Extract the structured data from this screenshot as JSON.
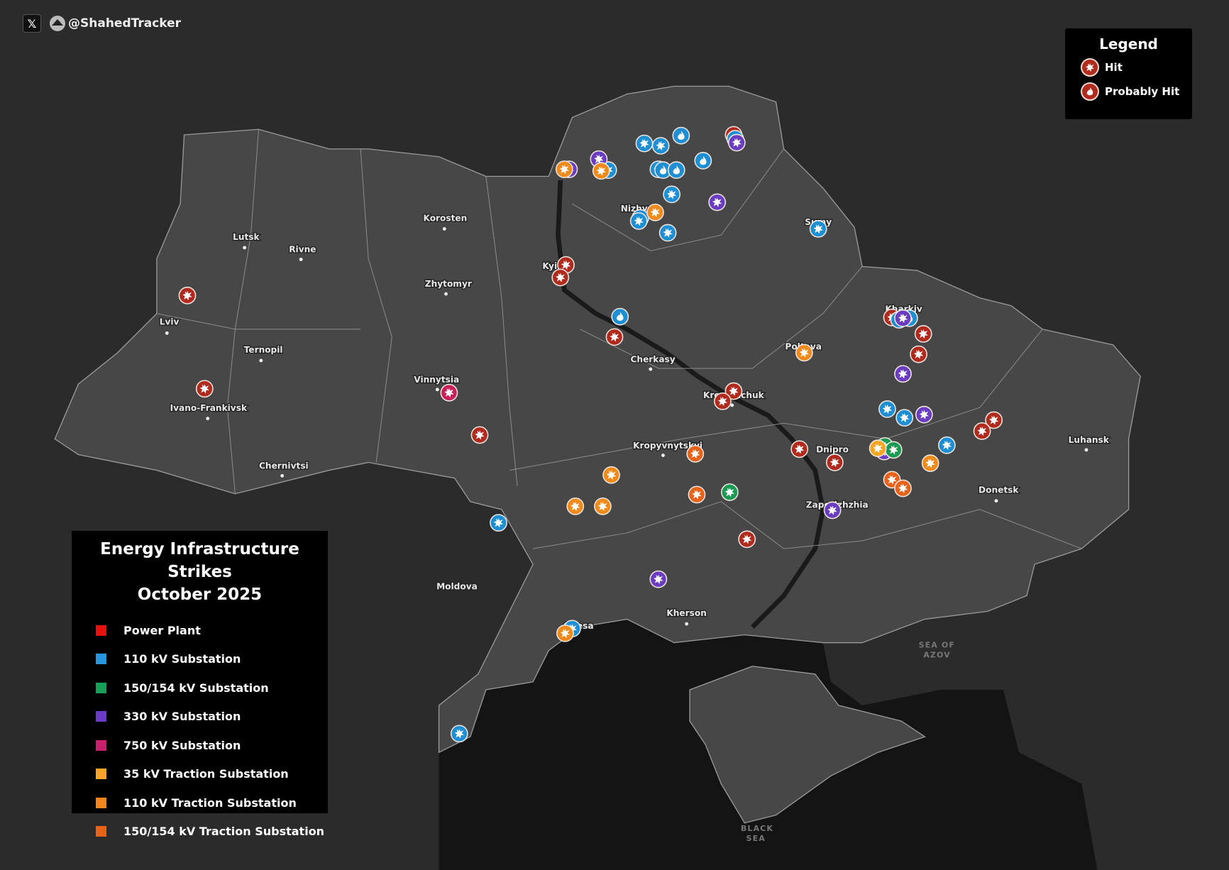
{
  "brand": {
    "x_icon": "x-logo-icon",
    "handle": "@ShahedTracker"
  },
  "status_legend": {
    "title": "Legend",
    "items": [
      {
        "label": "Hit",
        "icon": "explosion-icon"
      },
      {
        "label": "Probably Hit",
        "icon": "fire-icon"
      }
    ]
  },
  "key": {
    "title_line1": "Energy Infrastructure Strikes",
    "title_line2": "October 2025",
    "categories": [
      {
        "id": "power_plant",
        "label": "Power Plant",
        "color": "#e8100e"
      },
      {
        "id": "sub110",
        "label": "110 kV Substation",
        "color": "#2a96dc"
      },
      {
        "id": "sub150",
        "label": "150/154 kV Substation",
        "color": "#16a05a"
      },
      {
        "id": "sub330",
        "label": "330 kV Substation",
        "color": "#6a3cc4"
      },
      {
        "id": "sub750",
        "label": "750 kV Substation",
        "color": "#c8206a"
      },
      {
        "id": "tr35",
        "label": "35 kV Traction Substation",
        "color": "#f5a62a"
      },
      {
        "id": "tr110",
        "label": "110 kV Traction Substation",
        "color": "#f2861a"
      },
      {
        "id": "tr150",
        "label": "150/154 kV Traction Substation",
        "color": "#e8621a"
      }
    ]
  },
  "marker_colors": {
    "power_plant": "#b02a1e",
    "sub110": "#1e8fd2",
    "sub150": "#1a9a52",
    "sub330": "#6a3cc0",
    "sub750": "#c8205a",
    "tr35": "#f5a623",
    "tr110": "#f08a1a",
    "tr150": "#e8621a"
  },
  "map_colors": {
    "background": "#2b2b2b",
    "ukraine": "#474747",
    "sea": "#141414",
    "border": "#9a9a9a"
  },
  "cities": [
    "Korosten",
    "Lutsk",
    "Rivne",
    "Zhytomyr",
    "Lviv",
    "Ternopil",
    "Vinnytsia",
    "Ivano-Frankivsk",
    "Chernivtsi",
    "Cherkasy",
    "Kremenchuk",
    "Kropyvnytskyi",
    "Dnipro",
    "Zaporizhzhia",
    "Donetsk",
    "Luhansk",
    "Kharkiv",
    "Poltava",
    "Sumy",
    "Kyiv",
    "Nizhyn",
    "Odesa",
    "Kherson",
    "Moldova"
  ],
  "seas": {
    "azov_1": "SEA OF",
    "azov_2": "AZOV",
    "black_1": "BLACK",
    "black_2": "SEA"
  },
  "watermark": "@ShahedTracker",
  "markers": [
    {
      "category": "power_plant",
      "status": "hit"
    },
    {
      "category": "power_plant",
      "status": "hit"
    },
    {
      "category": "power_plant",
      "status": "hit"
    },
    {
      "category": "power_plant",
      "status": "hit"
    },
    {
      "category": "power_plant",
      "status": "hit"
    },
    {
      "category": "power_plant",
      "status": "hit"
    },
    {
      "category": "power_plant",
      "status": "hit"
    },
    {
      "category": "power_plant",
      "status": "hit"
    },
    {
      "category": "power_plant",
      "status": "hit"
    },
    {
      "category": "power_plant",
      "status": "hit"
    },
    {
      "category": "power_plant",
      "status": "hit"
    },
    {
      "category": "power_plant",
      "status": "hit"
    },
    {
      "category": "power_plant",
      "status": "hit"
    },
    {
      "category": "power_plant",
      "status": "hit"
    },
    {
      "category": "power_plant",
      "status": "hit"
    },
    {
      "category": "power_plant",
      "status": "hit"
    },
    {
      "category": "power_plant",
      "status": "hit"
    },
    {
      "category": "sub110",
      "status": "hit"
    },
    {
      "category": "sub110",
      "status": "hit"
    },
    {
      "category": "sub110",
      "status": "probable"
    },
    {
      "category": "sub110",
      "status": "probable"
    },
    {
      "category": "sub110",
      "status": "hit"
    },
    {
      "category": "sub110",
      "status": "probable"
    },
    {
      "category": "sub110",
      "status": "probable"
    },
    {
      "category": "sub110",
      "status": "hit"
    },
    {
      "category": "sub110",
      "status": "hit"
    },
    {
      "category": "sub110",
      "status": "hit"
    },
    {
      "category": "sub110",
      "status": "hit"
    },
    {
      "category": "sub110",
      "status": "hit"
    },
    {
      "category": "sub110",
      "status": "hit"
    },
    {
      "category": "sub110",
      "status": "probable"
    },
    {
      "category": "sub110",
      "status": "probable"
    },
    {
      "category": "sub110",
      "status": "hit"
    },
    {
      "category": "sub110",
      "status": "probable"
    },
    {
      "category": "sub110",
      "status": "hit"
    },
    {
      "category": "sub110",
      "status": "hit"
    },
    {
      "category": "sub110",
      "status": "hit"
    },
    {
      "category": "sub110",
      "status": "hit"
    },
    {
      "category": "sub110",
      "status": "hit"
    },
    {
      "category": "sub110",
      "status": "hit"
    },
    {
      "category": "sub330",
      "status": "hit"
    },
    {
      "category": "sub330",
      "status": "hit"
    },
    {
      "category": "sub330",
      "status": "hit"
    },
    {
      "category": "sub330",
      "status": "hit"
    },
    {
      "category": "sub330",
      "status": "hit"
    },
    {
      "category": "sub330",
      "status": "hit"
    },
    {
      "category": "sub330",
      "status": "hit"
    },
    {
      "category": "sub330",
      "status": "hit"
    },
    {
      "category": "sub330",
      "status": "hit"
    },
    {
      "category": "sub330",
      "status": "hit"
    },
    {
      "category": "sub150",
      "status": "hit"
    },
    {
      "category": "sub150",
      "status": "hit"
    },
    {
      "category": "sub150",
      "status": "hit"
    },
    {
      "category": "sub750",
      "status": "hit"
    },
    {
      "category": "tr35",
      "status": "hit"
    },
    {
      "category": "tr110",
      "status": "hit"
    },
    {
      "category": "tr110",
      "status": "hit"
    },
    {
      "category": "tr110",
      "status": "hit"
    },
    {
      "category": "tr110",
      "status": "hit"
    },
    {
      "category": "tr110",
      "status": "hit"
    },
    {
      "category": "tr110",
      "status": "hit"
    },
    {
      "category": "tr110",
      "status": "hit"
    },
    {
      "category": "tr110",
      "status": "hit"
    },
    {
      "category": "tr110",
      "status": "hit"
    },
    {
      "category": "tr150",
      "status": "hit"
    },
    {
      "category": "tr150",
      "status": "hit"
    },
    {
      "category": "tr150",
      "status": "hit"
    },
    {
      "category": "tr150",
      "status": "hit"
    }
  ]
}
